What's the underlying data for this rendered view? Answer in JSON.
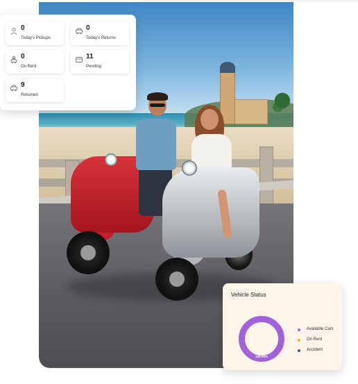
{
  "stats": [
    {
      "icon": "user-icon",
      "value": "0",
      "label": "Today's Pickups"
    },
    {
      "icon": "car-icon",
      "value": "0",
      "label": "Today's Returns"
    },
    {
      "icon": "person-car-icon",
      "value": "0",
      "label": "On Rent"
    },
    {
      "icon": "card-icon",
      "value": "11",
      "label": "Pending"
    },
    {
      "icon": "car-icon",
      "value": "9",
      "label": "Returned"
    }
  ],
  "vehicle_status": {
    "title": "Vehicle Status",
    "donut_label": "100.00%",
    "legend": [
      {
        "label": "Available Cars",
        "color": "#a262d9"
      },
      {
        "label": "On Rent",
        "color": "#e2b43a"
      },
      {
        "label": "Accident",
        "color": "#3a5a8f"
      }
    ]
  },
  "chart_data": {
    "type": "pie",
    "categories": [
      "Available Cars",
      "On Rent",
      "Accident"
    ],
    "values": [
      100,
      0,
      0
    ],
    "colors": [
      "#a262d9",
      "#e2b43a",
      "#3a5a8f"
    ],
    "title": "Vehicle Status",
    "center_label": "100.00%"
  },
  "hero_image": {
    "subject": "couple-on-scooters-photo"
  }
}
